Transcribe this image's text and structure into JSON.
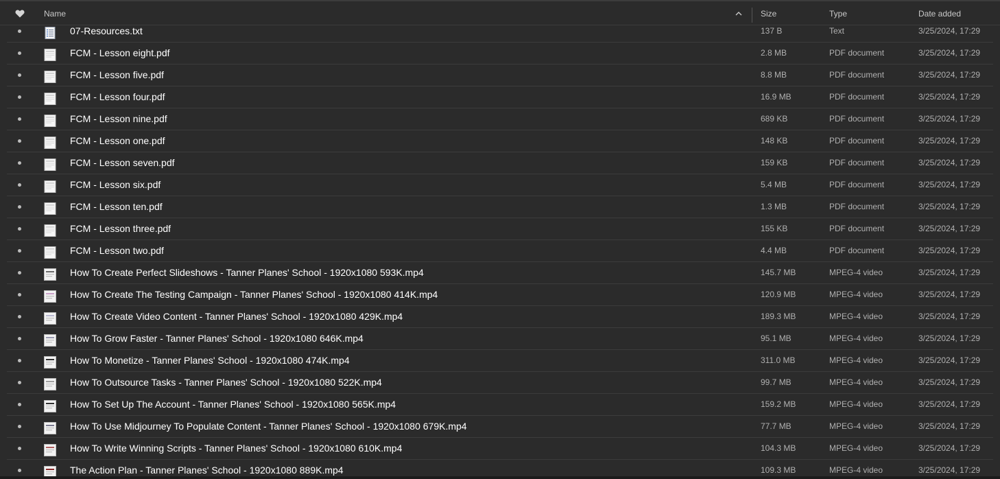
{
  "columns": {
    "name": "Name",
    "size": "Size",
    "type": "Type",
    "date": "Date added"
  },
  "colors": {
    "background": "#2b2b2b",
    "text_primary": "#ffffff",
    "text_secondary": "#b0b0b0"
  },
  "rows": [
    {
      "name": "07-Resources.txt",
      "size": "137 B",
      "type": "Text",
      "date": "3/25/2024, 17:29",
      "icon": "text-file-icon"
    },
    {
      "name": "FCM - Lesson eight.pdf",
      "size": "2.8 MB",
      "type": "PDF document",
      "date": "3/25/2024, 17:29",
      "icon": "pdf-thumbnail-icon"
    },
    {
      "name": "FCM - Lesson five.pdf",
      "size": "8.8 MB",
      "type": "PDF document",
      "date": "3/25/2024, 17:29",
      "icon": "pdf-thumbnail-icon"
    },
    {
      "name": "FCM - Lesson four.pdf",
      "size": "16.9 MB",
      "type": "PDF document",
      "date": "3/25/2024, 17:29",
      "icon": "pdf-thumbnail-icon"
    },
    {
      "name": "FCM - Lesson nine.pdf",
      "size": "689 KB",
      "type": "PDF document",
      "date": "3/25/2024, 17:29",
      "icon": "pdf-thumbnail-icon"
    },
    {
      "name": "FCM - Lesson one.pdf",
      "size": "148 KB",
      "type": "PDF document",
      "date": "3/25/2024, 17:29",
      "icon": "pdf-thumbnail-icon"
    },
    {
      "name": "FCM - Lesson seven.pdf",
      "size": "159 KB",
      "type": "PDF document",
      "date": "3/25/2024, 17:29",
      "icon": "pdf-thumbnail-icon"
    },
    {
      "name": "FCM - Lesson six.pdf",
      "size": "5.4 MB",
      "type": "PDF document",
      "date": "3/25/2024, 17:29",
      "icon": "pdf-thumbnail-icon"
    },
    {
      "name": "FCM - Lesson ten.pdf",
      "size": "1.3 MB",
      "type": "PDF document",
      "date": "3/25/2024, 17:29",
      "icon": "pdf-thumbnail-icon"
    },
    {
      "name": "FCM - Lesson three.pdf",
      "size": "155 KB",
      "type": "PDF document",
      "date": "3/25/2024, 17:29",
      "icon": "pdf-thumbnail-icon"
    },
    {
      "name": "FCM - Lesson two.pdf",
      "size": "4.4 MB",
      "type": "PDF document",
      "date": "3/25/2024, 17:29",
      "icon": "pdf-thumbnail-icon"
    },
    {
      "name": "How To Create Perfect Slideshows - Tanner Planes' School - 1920x1080 593K.mp4",
      "size": "145.7 MB",
      "type": "MPEG-4 video",
      "date": "3/25/2024, 17:29",
      "icon": "video-thumbnail-icon"
    },
    {
      "name": "How To Create The Testing Campaign - Tanner Planes' School - 1920x1080 414K.mp4",
      "size": "120.9 MB",
      "type": "MPEG-4 video",
      "date": "3/25/2024, 17:29",
      "icon": "video-thumbnail-icon"
    },
    {
      "name": "How To Create Video Content - Tanner Planes' School - 1920x1080 429K.mp4",
      "size": "189.3 MB",
      "type": "MPEG-4 video",
      "date": "3/25/2024, 17:29",
      "icon": "video-thumbnail-icon"
    },
    {
      "name": "How To Grow Faster - Tanner Planes' School - 1920x1080 646K.mp4",
      "size": "95.1 MB",
      "type": "MPEG-4 video",
      "date": "3/25/2024, 17:29",
      "icon": "video-thumbnail-icon"
    },
    {
      "name": "How To Monetize - Tanner Planes' School - 1920x1080 474K.mp4",
      "size": "311.0 MB",
      "type": "MPEG-4 video",
      "date": "3/25/2024, 17:29",
      "icon": "video-thumbnail-icon"
    },
    {
      "name": "How To Outsource Tasks - Tanner Planes' School - 1920x1080 522K.mp4",
      "size": "99.7 MB",
      "type": "MPEG-4 video",
      "date": "3/25/2024, 17:29",
      "icon": "video-thumbnail-icon"
    },
    {
      "name": "How To Set Up The Account - Tanner Planes' School - 1920x1080 565K.mp4",
      "size": "159.2 MB",
      "type": "MPEG-4 video",
      "date": "3/25/2024, 17:29",
      "icon": "video-thumbnail-icon"
    },
    {
      "name": "How To Use Midjourney To Populate Content - Tanner Planes' School - 1920x1080 679K.mp4",
      "size": "77.7 MB",
      "type": "MPEG-4 video",
      "date": "3/25/2024, 17:29",
      "icon": "video-thumbnail-icon"
    },
    {
      "name": "How To Write Winning Scripts - Tanner Planes' School - 1920x1080 610K.mp4",
      "size": "104.3 MB",
      "type": "MPEG-4 video",
      "date": "3/25/2024, 17:29",
      "icon": "video-thumbnail-icon"
    },
    {
      "name": "The Action Plan - Tanner Planes' School - 1920x1080 889K.mp4",
      "size": "109.3 MB",
      "type": "MPEG-4 video",
      "date": "3/25/2024, 17:29",
      "icon": "video-thumbnail-icon"
    }
  ]
}
